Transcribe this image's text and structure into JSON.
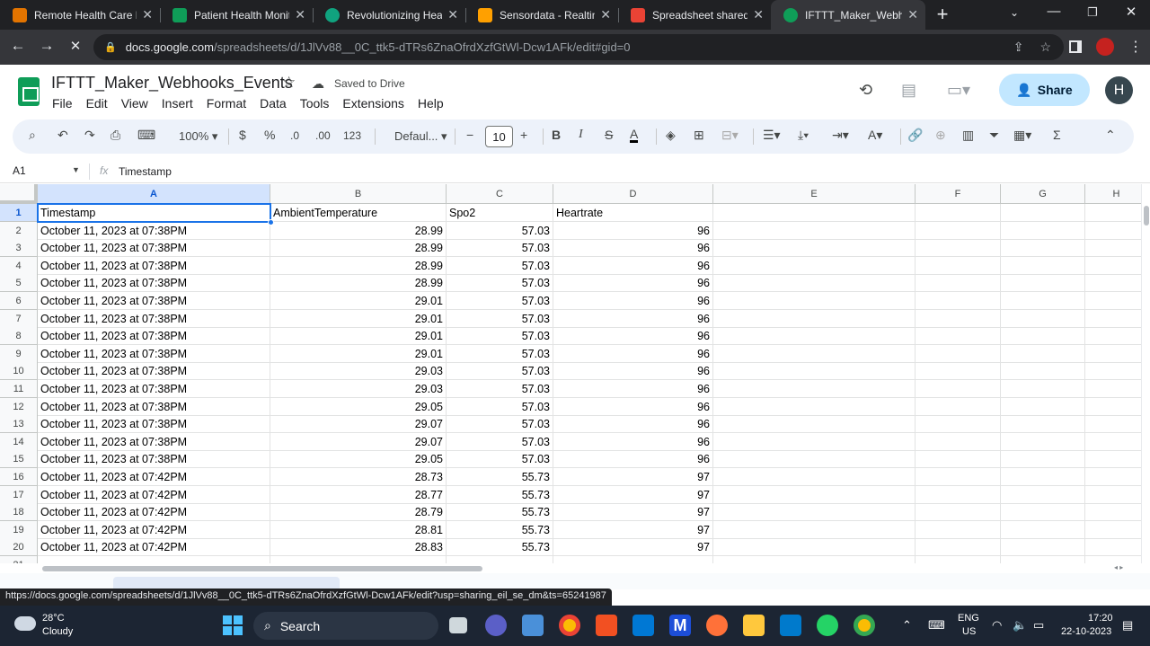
{
  "browser": {
    "tabs": [
      {
        "title": "Remote Health Care M",
        "favicon_color": "#e37400"
      },
      {
        "title": "Patient Health Monito",
        "favicon_color": "#0f9d58"
      },
      {
        "title": "Revolutionizing Heal",
        "favicon_color": "#10a37f"
      },
      {
        "title": "Sensordata - Realtim",
        "favicon_color": "#ffa000"
      },
      {
        "title": "Spreadsheet shared v",
        "favicon_color": "#ea4335"
      },
      {
        "title": "IFTTT_Maker_Webhoo",
        "favicon_color": "#0f9d58"
      }
    ],
    "url_host": "docs.google.com",
    "url_path": "/spreadsheets/d/1JlVv88__0C_ttk5-dTRs6ZnaOfrdXzfGtWl-Dcw1AFk/edit#gid=0"
  },
  "sheets": {
    "doc_title": "IFTTT_Maker_Webhooks_Events",
    "saved_status": "Saved to Drive",
    "menu": [
      "File",
      "Edit",
      "View",
      "Insert",
      "Format",
      "Data",
      "Tools",
      "Extensions",
      "Help"
    ],
    "share_label": "Share",
    "user_initial": "H",
    "toolbar": {
      "zoom": "100%",
      "currency": "$",
      "percent": "%",
      "dec_decrease": ".0",
      "dec_increase": ".00",
      "number_format": "123",
      "font": "Defaul...",
      "font_size": "10"
    },
    "name_box": "A1",
    "formula_value": "Timestamp",
    "columns": [
      "A",
      "B",
      "C",
      "D",
      "E",
      "F",
      "G",
      "H"
    ],
    "header_row": [
      "Timestamp",
      "AmbientTemperature",
      "Spo2",
      "Heartrate"
    ],
    "rows": [
      [
        "October 11, 2023 at 07:38PM",
        "28.99",
        "57.03",
        "96"
      ],
      [
        "October 11, 2023 at 07:38PM",
        "28.99",
        "57.03",
        "96"
      ],
      [
        "October 11, 2023 at 07:38PM",
        "28.99",
        "57.03",
        "96"
      ],
      [
        "October 11, 2023 at 07:38PM",
        "28.99",
        "57.03",
        "96"
      ],
      [
        "October 11, 2023 at 07:38PM",
        "29.01",
        "57.03",
        "96"
      ],
      [
        "October 11, 2023 at 07:38PM",
        "29.01",
        "57.03",
        "96"
      ],
      [
        "October 11, 2023 at 07:38PM",
        "29.01",
        "57.03",
        "96"
      ],
      [
        "October 11, 2023 at 07:38PM",
        "29.01",
        "57.03",
        "96"
      ],
      [
        "October 11, 2023 at 07:38PM",
        "29.03",
        "57.03",
        "96"
      ],
      [
        "October 11, 2023 at 07:38PM",
        "29.03",
        "57.03",
        "96"
      ],
      [
        "October 11, 2023 at 07:38PM",
        "29.05",
        "57.03",
        "96"
      ],
      [
        "October 11, 2023 at 07:38PM",
        "29.07",
        "57.03",
        "96"
      ],
      [
        "October 11, 2023 at 07:38PM",
        "29.07",
        "57.03",
        "96"
      ],
      [
        "October 11, 2023 at 07:38PM",
        "29.05",
        "57.03",
        "96"
      ],
      [
        "October 11, 2023 at 07:42PM",
        "28.73",
        "55.73",
        "97"
      ],
      [
        "October 11, 2023 at 07:42PM",
        "28.77",
        "55.73",
        "97"
      ],
      [
        "October 11, 2023 at 07:42PM",
        "28.79",
        "55.73",
        "97"
      ],
      [
        "October 11, 2023 at 07:42PM",
        "28.81",
        "55.73",
        "97"
      ],
      [
        "October 11, 2023 at 07:42PM",
        "28.83",
        "55.73",
        "97"
      ]
    ]
  },
  "status_url": "https://docs.google.com/spreadsheets/d/1JlVv88__0C_ttk5-dTRs6ZnaOfrdXzfGtWl-Dcw1AFk/edit?usp=sharing_eil_se_dm&ts=65241987",
  "taskbar": {
    "weather_temp": "28°C",
    "weather_desc": "Cloudy",
    "search_label": "Search",
    "lang_line1": "ENG",
    "lang_line2": "US",
    "time": "17:20",
    "date": "22-10-2023"
  }
}
